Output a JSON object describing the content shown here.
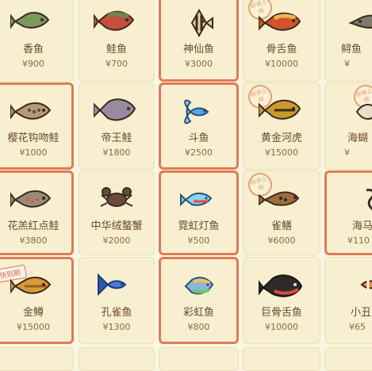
{
  "currency_symbol": "¥",
  "grid": {
    "cards": [
      {
        "name": "香鱼",
        "price": "¥900",
        "icon": "fish-icon"
      },
      {
        "name": "鲑鱼",
        "price": "¥700",
        "icon": "salmon-icon"
      },
      {
        "name": "神仙鱼",
        "price": "¥3000",
        "icon": "angelfish-icon",
        "highlight": true
      },
      {
        "name": "骨舌鱼",
        "price": "¥10000",
        "icon": "arowana-icon",
        "seal": "即将上线"
      },
      {
        "name": "鲟鱼",
        "price": "¥",
        "icon": "sturgeon-icon"
      },
      {
        "name": "樱花钩吻鲑",
        "price": "¥1000",
        "icon": "cherry-salmon-icon",
        "highlight": true
      },
      {
        "name": "帝王鲑",
        "price": "¥1800",
        "icon": "king-salmon-icon"
      },
      {
        "name": "斗鱼",
        "price": "¥2500",
        "icon": "betta-icon",
        "highlight": true
      },
      {
        "name": "黄金河虎",
        "price": "¥15000",
        "icon": "golden-trout-icon",
        "seal": "即将上线"
      },
      {
        "name": "海蝴",
        "price": "¥",
        "icon": "sea-butterfly-icon",
        "seal": "即将上线"
      },
      {
        "name": "花羔红点鲑",
        "price": "¥3800",
        "icon": "char-icon",
        "highlight": true
      },
      {
        "name": "中华绒螯蟹",
        "price": "¥2000",
        "icon": "crab-icon"
      },
      {
        "name": "霓虹灯鱼",
        "price": "¥500",
        "icon": "neon-tetra-icon",
        "highlight": true
      },
      {
        "name": "雀鳝",
        "price": "¥6000",
        "icon": "gar-icon",
        "seal": "即将上线"
      },
      {
        "name": "海马",
        "price": "¥110",
        "icon": "seahorse-icon",
        "highlight": true
      },
      {
        "name": "金鳟",
        "price": "¥15000",
        "icon": "golden-trout-icon",
        "highlight": true,
        "badge": "快到期"
      },
      {
        "name": "孔雀鱼",
        "price": "¥1300",
        "icon": "guppy-icon"
      },
      {
        "name": "彩虹鱼",
        "price": "¥800",
        "icon": "rainbowfish-icon",
        "highlight": true
      },
      {
        "name": "巨骨舌鱼",
        "price": "¥10000",
        "icon": "arapaima-icon"
      },
      {
        "name": "小丑",
        "price": "¥65",
        "icon": "clownfish-icon"
      }
    ]
  }
}
